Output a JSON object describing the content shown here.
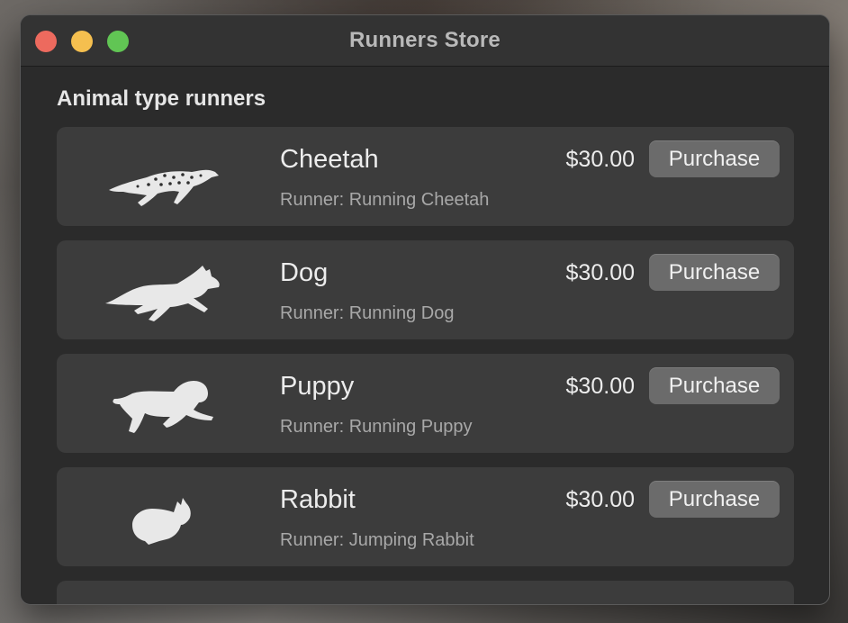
{
  "window": {
    "title": "Runners Store"
  },
  "section": {
    "title": "Animal type runners"
  },
  "items": [
    {
      "name": "Cheetah",
      "subtitle": "Runner: Running Cheetah",
      "price": "$30.00",
      "button": "Purchase",
      "icon": "cheetah-icon"
    },
    {
      "name": "Dog",
      "subtitle": "Runner: Running Dog",
      "price": "$30.00",
      "button": "Purchase",
      "icon": "dog-icon"
    },
    {
      "name": "Puppy",
      "subtitle": "Runner: Running Puppy",
      "price": "$30.00",
      "button": "Purchase",
      "icon": "puppy-icon"
    },
    {
      "name": "Rabbit",
      "subtitle": "Runner: Jumping Rabbit",
      "price": "$30.00",
      "button": "Purchase",
      "icon": "rabbit-icon"
    }
  ],
  "colors": {
    "window_bg": "#2b2b2b",
    "card_bg": "#3c3c3c",
    "button_bg": "#6b6b6b",
    "close": "#ed6a5e",
    "minimize": "#f5bf4f",
    "maximize": "#61c554"
  }
}
